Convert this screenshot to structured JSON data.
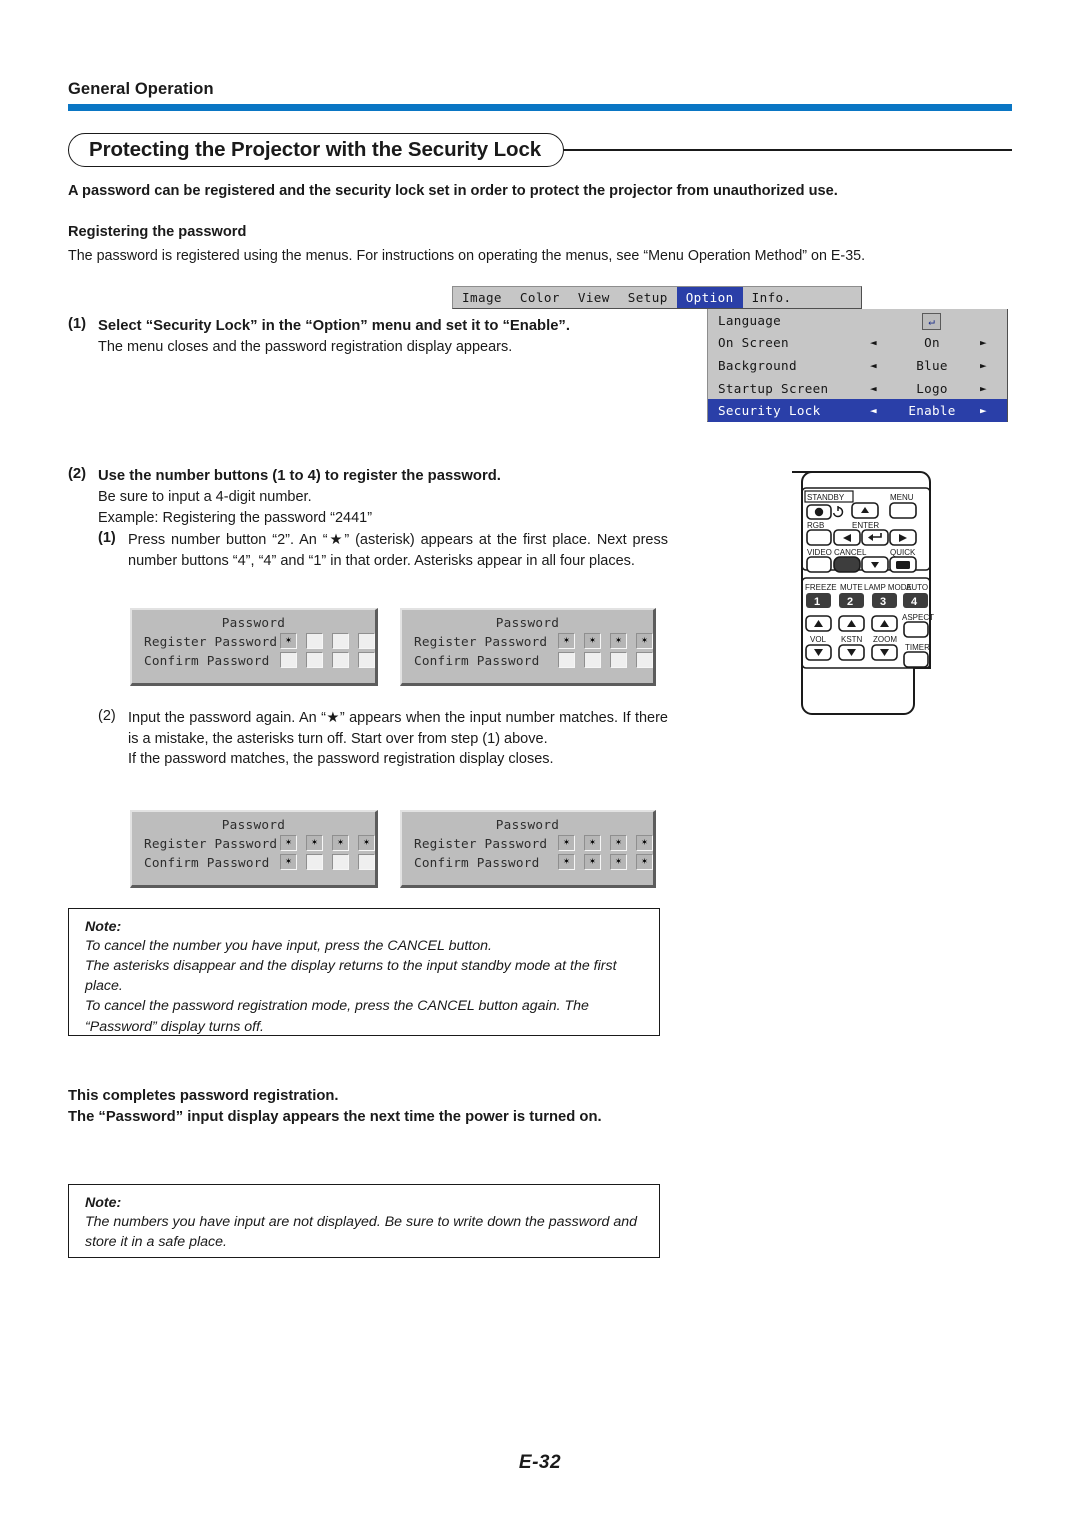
{
  "page": {
    "running_head": "General Operation",
    "page_number": "E-32",
    "rule_color": "#0a76c4"
  },
  "title": {
    "text": "Protecting the Projector with the Security Lock"
  },
  "intro": {
    "lead": "A password can be registered and the security lock set in order to protect the projector from unauthorized use.",
    "subheading": "Registering the password",
    "subtext": "The password is registered using the menus. For instructions on operating the menus, see “Menu Operation Method” on E-35."
  },
  "steps": [
    {
      "num": "(1)",
      "heading": "Select “Security Lock” in the “Option” menu and set it to “Enable”.",
      "text": "The menu closes and the password registration display appears."
    },
    {
      "num": "(2)",
      "heading": "Use the number buttons (1 to 4) to register the password.",
      "line1": "Be sure to input a 4-digit number.",
      "line2": "Example: Registering the password “2441”",
      "sub1_num": "(1)",
      "sub1_text": "Press number button “2”. An “★” (asterisk) appears at the first place. Next press number buttons “4”, “4” and “1” in that order. Asterisks appear in all four places.",
      "sub2_num": "(2)",
      "sub2_text": "Input the password again. An “★” appears when the input number matches. If there is a mistake, the asterisks turn off. Start over from step (1) above.",
      "sub2_text2": "If the password matches, the password registration display closes."
    }
  ],
  "osd": {
    "tabs": [
      {
        "label": "Image",
        "selected": false
      },
      {
        "label": "Color",
        "selected": false
      },
      {
        "label": "View",
        "selected": false
      },
      {
        "label": "Setup",
        "selected": false
      },
      {
        "label": "Option",
        "selected": true
      },
      {
        "label": "Info.",
        "selected": false
      }
    ],
    "rows": [
      {
        "label": "Language",
        "value": "",
        "arrows": false,
        "enter": true,
        "selected": false
      },
      {
        "label": "On Screen",
        "value": "On",
        "arrows": true,
        "enter": false,
        "selected": false
      },
      {
        "label": "Background",
        "value": "Blue",
        "arrows": true,
        "enter": false,
        "selected": false
      },
      {
        "label": "Startup Screen",
        "value": "Logo",
        "arrows": true,
        "enter": false,
        "selected": false
      },
      {
        "label": "Security Lock",
        "value": "Enable",
        "arrows": true,
        "enter": false,
        "selected": true
      }
    ],
    "left_arrow": "◄",
    "right_arrow": "►",
    "enter_glyph": "↵",
    "highlight_color": "#2a3fa8",
    "panel_color": "#c6c6c6"
  },
  "password_dialogs": [
    {
      "id": "dlg-1a",
      "title": "Password",
      "register_label": "Register Password",
      "confirm_label": "Confirm Password",
      "register_cells": [
        true,
        false,
        false,
        false
      ],
      "confirm_cells": [
        false,
        false,
        false,
        false
      ]
    },
    {
      "id": "dlg-1b",
      "title": "Password",
      "register_label": "Register Password",
      "confirm_label": "Confirm Password",
      "register_cells": [
        true,
        true,
        true,
        true
      ],
      "confirm_cells": [
        false,
        false,
        false,
        false
      ]
    },
    {
      "id": "dlg-2a",
      "title": "Password",
      "register_label": "Register Password",
      "confirm_label": "Confirm Password",
      "register_cells": [
        true,
        true,
        true,
        true
      ],
      "confirm_cells": [
        true,
        false,
        false,
        false
      ]
    },
    {
      "id": "dlg-2b",
      "title": "Password",
      "register_label": "Register Password",
      "confirm_label": "Confirm Password",
      "register_cells": [
        true,
        true,
        true,
        true
      ],
      "confirm_cells": [
        true,
        true,
        true,
        true
      ]
    }
  ],
  "cell_asterisk": "✶",
  "notes": [
    {
      "title": "Note:",
      "lines": [
        "To cancel the number you have input, press the CANCEL button.",
        "The asterisks disappear and the display returns to the input standby mode at the first place.",
        "To cancel the password registration mode, press the CANCEL button again. The “Password” display turns off."
      ]
    },
    {
      "title": "Note:",
      "lines": [
        "The numbers you have input are not displayed. Be sure to write down the password and store it in a safe place."
      ]
    }
  ],
  "closing": {
    "line1": "This completes password registration.",
    "line2": "The “Password” input display appears the next time the power is turned on."
  },
  "remote": {
    "labels": {
      "standby": "STANDBY",
      "menu": "MENU",
      "rgb": "RGB",
      "enter": "ENTER",
      "video": "VIDEO",
      "cancel": "CANCEL",
      "quick": "QUICK",
      "freeze": "FREEZE",
      "mute": "MUTE",
      "lamp_mode": "LAMP MODE",
      "auto": "AUTO",
      "aspect": "ASPECT",
      "vol": "VOL",
      "kstn": "KSTN",
      "zoom": "ZOOM",
      "timer": "TIMER"
    },
    "number_buttons": [
      "1",
      "2",
      "3",
      "4"
    ]
  }
}
